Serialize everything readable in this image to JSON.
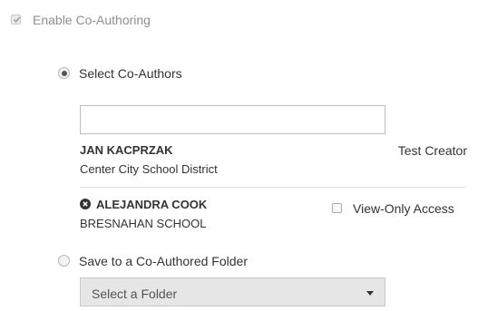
{
  "enable_coauthoring": {
    "label": "Enable Co-Authoring",
    "checked": true
  },
  "select_coauthors": {
    "label": "Select Co-Authors",
    "selected": true
  },
  "search": {
    "value": "",
    "placeholder": ""
  },
  "authors": [
    {
      "name": "JAN KACPRZAK",
      "organization": "Center City School District",
      "role": "Test Creator"
    },
    {
      "name": "ALEJANDRA COOK",
      "organization": "BRESNAHAN SCHOOL",
      "access_label": "View-Only Access",
      "access_checked": false
    }
  ],
  "save_folder": {
    "label": "Save to a Co-Authored Folder",
    "selected": false
  },
  "folder_select": {
    "value": "Select a Folder"
  },
  "icons": {
    "checkmark": "check-icon",
    "remove": "close-circle-icon",
    "dropdown": "caret-down-icon"
  },
  "colors": {
    "text": "#333333",
    "muted": "#8f8f8f",
    "border": "#bdbdbd"
  }
}
